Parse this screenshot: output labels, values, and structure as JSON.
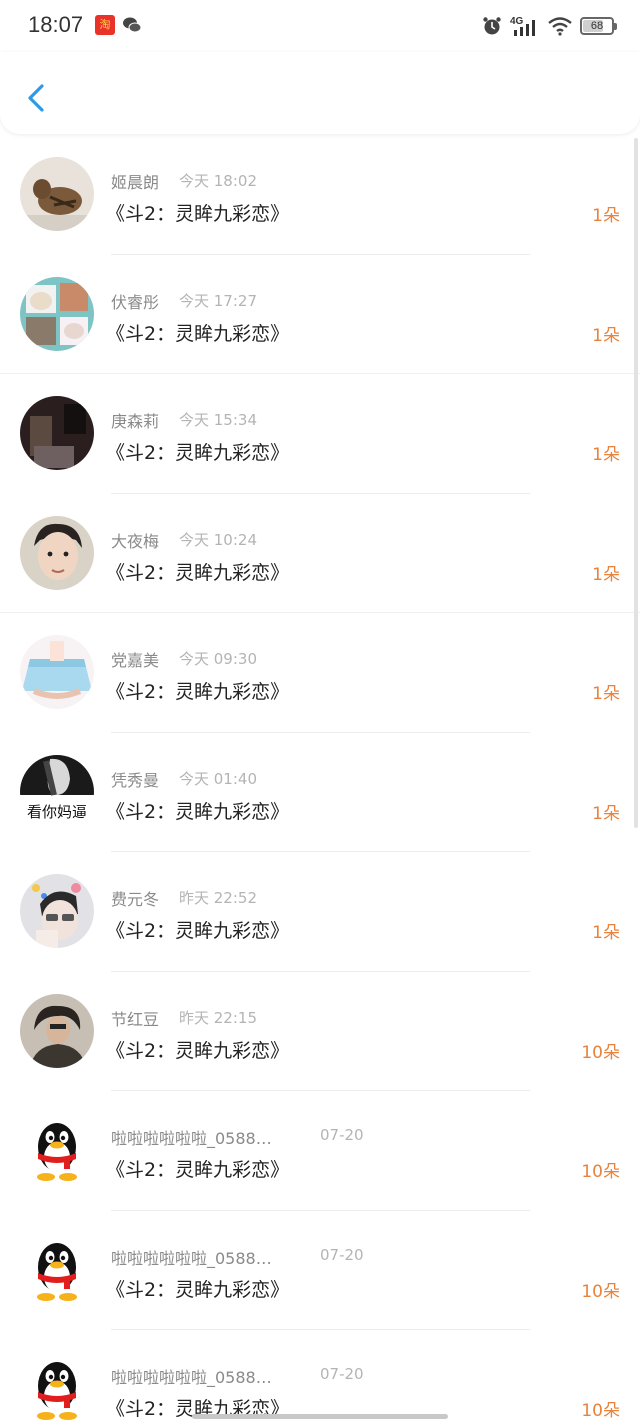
{
  "status_bar": {
    "time": "18:07",
    "network": "4G",
    "battery": "68",
    "battery_level": 0.68
  },
  "nav": {
    "back_icon": "chevron-left-icon",
    "accent": "#2d9ae8"
  },
  "count_color": "#e8823c",
  "items": [
    {
      "name": "姬晨朗",
      "time": "今天 18:02",
      "title": "《斗2：灵眸九彩恋》",
      "count": "1朵",
      "avatar": "cat-photo"
    },
    {
      "name": "伏睿彤",
      "time": "今天 17:27",
      "title": "《斗2：灵眸九彩恋》",
      "count": "1朵",
      "avatar": "pet-collage"
    },
    {
      "name": "庚森莉",
      "time": "今天 15:34",
      "title": "《斗2：灵眸九彩恋》",
      "count": "1朵",
      "avatar": "dark-photo"
    },
    {
      "name": "大夜梅",
      "time": "今天 10:24",
      "title": "《斗2：灵眸九彩恋》",
      "count": "1朵",
      "avatar": "boy-photo"
    },
    {
      "name": "党嘉美",
      "time": "今天 09:30",
      "title": "《斗2：灵眸九彩恋》",
      "count": "1朵",
      "avatar": "anime-skirt"
    },
    {
      "name": "凭秀曼",
      "time": "今天 01:40",
      "title": "《斗2：灵眸九彩恋》",
      "count": "1朵",
      "avatar": "bw-text",
      "avatar_text": "看你妈逼"
    },
    {
      "name": "费元冬",
      "time": "昨天 22:52",
      "title": "《斗2：灵眸九彩恋》",
      "count": "1朵",
      "avatar": "selfie"
    },
    {
      "name": "节红豆",
      "time": "昨天 22:15",
      "title": "《斗2：灵眸九彩恋》",
      "count": "10朵",
      "avatar": "person-dark"
    },
    {
      "name": "啦啦啦啦啦啦_0588…",
      "time": "07-20",
      "title": "《斗2：灵眸九彩恋》",
      "count": "10朵",
      "avatar": "qq-penguin"
    },
    {
      "name": "啦啦啦啦啦啦_0588…",
      "time": "07-20",
      "title": "《斗2：灵眸九彩恋》",
      "count": "10朵",
      "avatar": "qq-penguin"
    },
    {
      "name": "啦啦啦啦啦啦_0588…",
      "time": "07-20",
      "title": "《斗2：灵眸九彩恋》",
      "count": "10朵",
      "avatar": "qq-penguin"
    }
  ]
}
